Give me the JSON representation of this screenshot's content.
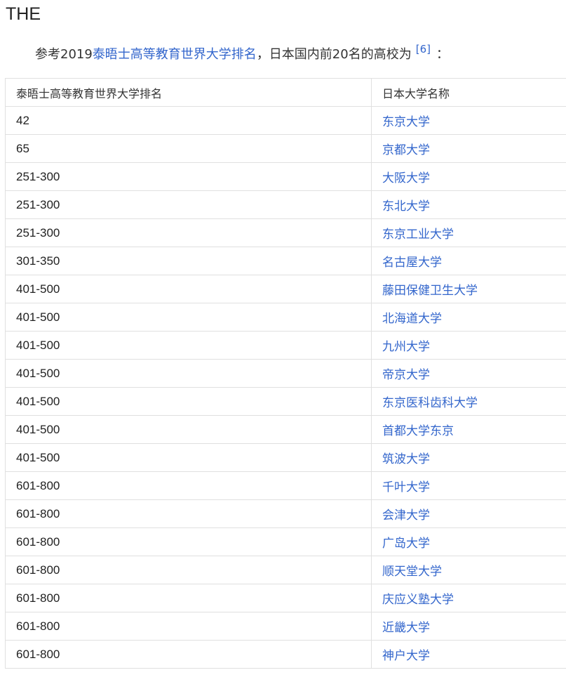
{
  "section": {
    "title": "THE"
  },
  "intro": {
    "prefix": "参考2019",
    "link": "泰晤士高等教育世界大学排名",
    "suffix": "，日本国内前20名的高校为",
    "ref": "[6]",
    "tail": "："
  },
  "table": {
    "headers": [
      "泰晤士高等教育世界大学排名",
      "日本大学名称"
    ],
    "rows": [
      {
        "rank": "42",
        "name": "东京大学"
      },
      {
        "rank": "65",
        "name": "京都大学"
      },
      {
        "rank": "251-300",
        "name": "大阪大学"
      },
      {
        "rank": "251-300",
        "name": "东北大学"
      },
      {
        "rank": "251-300",
        "name": "东京工业大学"
      },
      {
        "rank": "301-350",
        "name": "名古屋大学"
      },
      {
        "rank": "401-500",
        "name": "藤田保健卫生大学"
      },
      {
        "rank": "401-500",
        "name": "北海道大学"
      },
      {
        "rank": "401-500",
        "name": "九州大学"
      },
      {
        "rank": "401-500",
        "name": "帝京大学"
      },
      {
        "rank": "401-500",
        "name": "东京医科齿科大学"
      },
      {
        "rank": "401-500",
        "name": "首都大学东京"
      },
      {
        "rank": "401-500",
        "name": "筑波大学"
      },
      {
        "rank": "601-800",
        "name": "千叶大学"
      },
      {
        "rank": "601-800",
        "name": "会津大学"
      },
      {
        "rank": "601-800",
        "name": "广岛大学"
      },
      {
        "rank": "601-800",
        "name": "顺天堂大学"
      },
      {
        "rank": "601-800",
        "name": "庆应义塾大学"
      },
      {
        "rank": "601-800",
        "name": "近畿大学"
      },
      {
        "rank": "601-800",
        "name": "神户大学"
      }
    ]
  },
  "colors": {
    "link": "#3366cc",
    "text": "#222222",
    "border": "#e0e0e0"
  }
}
